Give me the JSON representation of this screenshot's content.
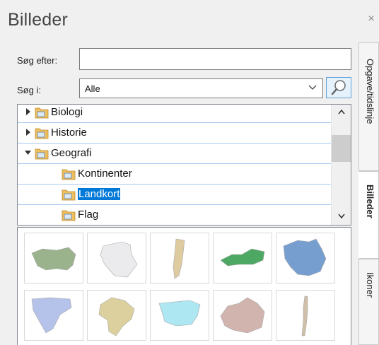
{
  "panel": {
    "title": "Billeder",
    "close_glyph": "×"
  },
  "search": {
    "label": "Søg efter:",
    "value": "",
    "in_label": "Søg i:",
    "scope_value": "Alle",
    "button_icon": "magnifier-icon"
  },
  "tree": {
    "items": [
      {
        "label": "Biologi",
        "level": 0,
        "expander": "collapsed",
        "selected": false
      },
      {
        "label": "Historie",
        "level": 0,
        "expander": "collapsed",
        "selected": false
      },
      {
        "label": "Geografi",
        "level": 0,
        "expander": "expanded",
        "selected": false
      },
      {
        "label": "Kontinenter",
        "level": 1,
        "expander": "none",
        "selected": false
      },
      {
        "label": "Landkort",
        "level": 1,
        "expander": "none",
        "selected": true
      },
      {
        "label": "Flag",
        "level": 1,
        "expander": "none",
        "selected": false
      }
    ]
  },
  "thumbnails": [
    {
      "icon": "usa-map-icon",
      "color": "#8aa67a"
    },
    {
      "icon": "algeria-map-icon",
      "color": "#e8e8ea"
    },
    {
      "icon": "argentina-map-icon",
      "color": "#d9c28f"
    },
    {
      "icon": "austria-map-icon",
      "color": "#2f9a4a"
    },
    {
      "icon": "australia-map-icon",
      "color": "#5f8fc8"
    },
    {
      "icon": "bosnia-map-icon",
      "color": "#a9b8e6"
    },
    {
      "icon": "brazil-map-icon",
      "color": "#d7c98e"
    },
    {
      "icon": "bulgaria-map-icon",
      "color": "#9fe3f0"
    },
    {
      "icon": "canada-map-icon",
      "color": "#c9a8a0"
    },
    {
      "icon": "chile-map-icon",
      "color": "#c8b49a"
    }
  ],
  "side_tabs": [
    {
      "label": "Opgave/tidslinje",
      "active": false
    },
    {
      "label": "Billeder",
      "active": true
    },
    {
      "label": "Ikoner",
      "active": false
    }
  ],
  "colors": {
    "selection": "#0078d7",
    "row_border": "#a4c8ee",
    "folder": "#f0c060"
  }
}
